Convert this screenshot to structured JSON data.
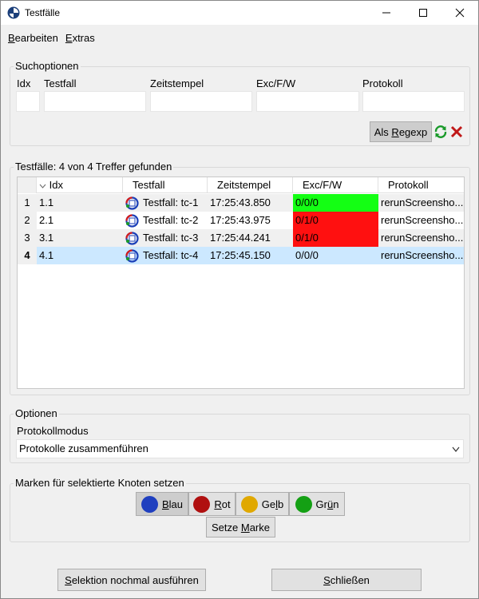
{
  "window": {
    "title": "Testfälle",
    "minimize": "—",
    "maximize": "☐",
    "close": "✕"
  },
  "menu": {
    "items": [
      {
        "label": "Bearbeiten",
        "mnemonic": "B",
        "rest": "earbeiten"
      },
      {
        "label": "Extras",
        "mnemonic": "E",
        "rest": "xtras"
      }
    ]
  },
  "search": {
    "legend": "Suchoptionen",
    "labels": [
      "Idx",
      "Testfall",
      "Zeitstempel",
      "Exc/F/W",
      "Protokoll"
    ],
    "values": [
      "",
      "",
      "",
      "",
      ""
    ],
    "regexp_button": "Als Regexp",
    "regexp_mnemonic": "R",
    "regexp_prefix": "Als ",
    "regexp_rest": "egexp"
  },
  "results": {
    "legend": "Testfälle: 4 von 4 Treffer gefunden",
    "columns": [
      "Idx",
      "Testfall",
      "Zeitstempel",
      "Exc/F/W",
      "Protokoll"
    ],
    "rows": [
      {
        "num": "1",
        "idx": "1.1",
        "testfall": "Testfall: tc-1",
        "zeit": "17:25:43.850",
        "exc": "0/0/0",
        "protokoll": "rerunScreensho...",
        "status": "green"
      },
      {
        "num": "2",
        "idx": "2.1",
        "testfall": "Testfall: tc-2",
        "zeit": "17:25:43.975",
        "exc": "0/1/0",
        "protokoll": "rerunScreensho...",
        "status": "red"
      },
      {
        "num": "3",
        "idx": "3.1",
        "testfall": "Testfall: tc-3",
        "zeit": "17:25:44.241",
        "exc": "0/1/0",
        "protokoll": "rerunScreensho...",
        "status": "red"
      },
      {
        "num": "4",
        "idx": "4.1",
        "testfall": "Testfall: tc-4",
        "zeit": "17:25:45.150",
        "exc": "0/0/0",
        "protokoll": "rerunScreensho...",
        "status": "selected"
      }
    ]
  },
  "options": {
    "legend": "Optionen",
    "mode_label": "Protokollmodus",
    "mode_value": "Protokolle zusammenführen"
  },
  "marks": {
    "legend": "Marken für selektierte Knoten setzen",
    "buttons": [
      {
        "label": "Blau",
        "mnemonic": "B",
        "rest": "lau",
        "color": "#1f3fbf"
      },
      {
        "label": "Rot",
        "mnemonic": "R",
        "rest": "ot",
        "color": "#b01010"
      },
      {
        "label": "Gelb",
        "prefix": "Ge",
        "mnemonic": "l",
        "rest": "b",
        "color": "#e0a800"
      },
      {
        "label": "Grün",
        "prefix": "Gr",
        "mnemonic": "ü",
        "rest": "n",
        "color": "#14a014"
      }
    ],
    "set_mark": "Setze Marke",
    "set_mark_prefix": "Setze ",
    "set_mark_mnemonic": "M",
    "set_mark_rest": "arke"
  },
  "footer": {
    "rerun": "Selektion nochmal ausführen",
    "rerun_mnemonic": "S",
    "rerun_rest": "elektion nochmal ausführen",
    "close": "Schließen",
    "close_mnemonic": "S",
    "close_rest": "chließen"
  },
  "colors": {
    "green": "#14ff14",
    "red": "#ff1010",
    "selected": "#cce8ff"
  }
}
